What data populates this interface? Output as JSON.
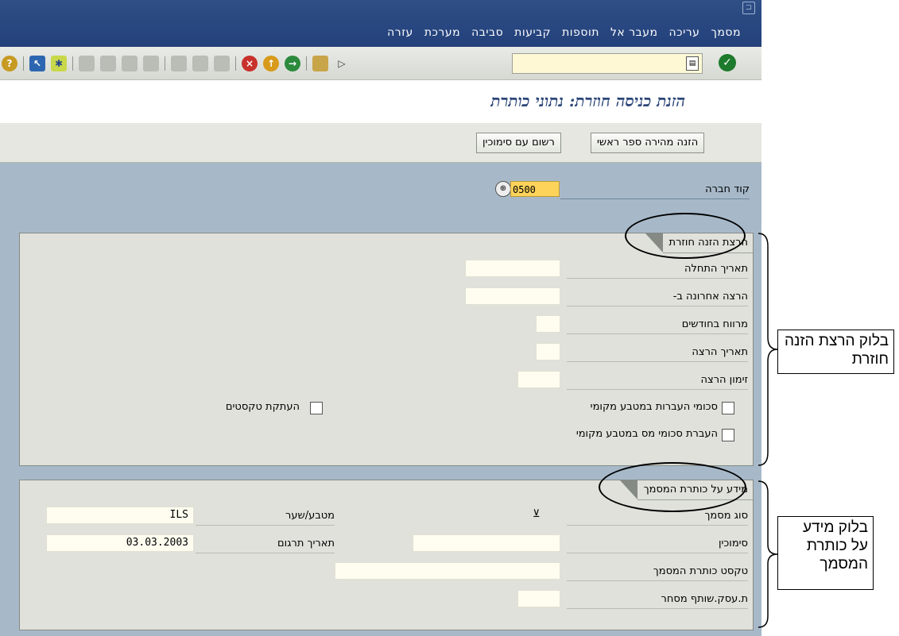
{
  "menu": [
    "מסמך",
    "עריכה",
    "מעבר אל",
    "תוספות",
    "קביעות",
    "סביבה",
    "מערכת",
    "עזרה"
  ],
  "title": "הזנת כניסה חוזרת: נתוני כותרת",
  "app_toolbar": {
    "btn_fast_entry": "הזנה מהירה ספר ראשי",
    "btn_post_ref": "רשום עם סימוכין"
  },
  "company": {
    "label": "קוד חברה",
    "value": "0500"
  },
  "recurring": {
    "title": "הרצת הזנה חוזרת",
    "first_run_label": "תאריך התחלה",
    "last_run_label": "הרצה אחרונה ב-",
    "interval_label": "מרווח בחודשים",
    "run_date_label": "תאריך הרצה",
    "run_schedule_label": "זימון הרצה",
    "cb_transfer_amounts": "סכומי העברות במטבע מקומי",
    "cb_transfer_tax": "העברת סכומי מס במטבע מקומי",
    "cb_copy_texts": "העתקת טקסטים"
  },
  "header": {
    "title": "מידע על כותרת המסמך",
    "doc_type_label": "סוג מסמך",
    "reference_label": "סימוכין",
    "doc_header_text_label": "טקסט כותרת המסמך",
    "trading_partner_label": "ת.עסק.שותף מסחר",
    "currency_label": "מטבע/שער",
    "currency_value": "ILS",
    "translation_date_label": "תאריך תרגום",
    "translation_date_value": "03.03.2003"
  },
  "callouts": {
    "block_recurring": "בלוק הרצת הזנה חוזרת",
    "block_header": "בלוק מידע על כותרת המסמך"
  },
  "colors": {
    "menubar": "#2f4f86",
    "screen_bg": "#a7b9c9",
    "title": "#2d4778",
    "group_bg": "#e0e1db",
    "input_required": "#fdd35a"
  }
}
